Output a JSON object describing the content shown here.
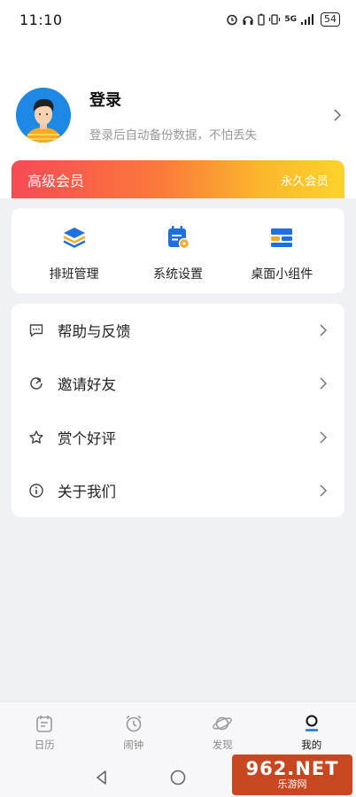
{
  "status_bar": {
    "time": "11:10",
    "network": "5G",
    "battery": "54"
  },
  "profile": {
    "title": "登录",
    "subtitle": "登录后自动备份数据，不怕丢失"
  },
  "member": {
    "left_label": "高级会员",
    "right_label": "永久会员"
  },
  "quick_actions": [
    {
      "label": "排班管理",
      "icon": "layers-icon"
    },
    {
      "label": "系统设置",
      "icon": "calendar-settings-icon"
    },
    {
      "label": "桌面小组件",
      "icon": "widget-icon"
    }
  ],
  "menu": [
    {
      "label": "帮助与反馈",
      "icon": "message-icon"
    },
    {
      "label": "邀请好友",
      "icon": "share-icon"
    },
    {
      "label": "赏个好评",
      "icon": "star-icon"
    },
    {
      "label": "关于我们",
      "icon": "info-icon"
    }
  ],
  "tabs": [
    {
      "label": "日历",
      "icon": "calendar-icon",
      "active": false
    },
    {
      "label": "闹钟",
      "icon": "alarm-icon",
      "active": false
    },
    {
      "label": "发现",
      "icon": "planet-icon",
      "active": false
    },
    {
      "label": "我的",
      "icon": "user-icon",
      "active": true
    }
  ],
  "watermark": {
    "top": "962.NET",
    "bottom": "乐游网"
  },
  "colors": {
    "accent_blue": "#1e6fe0",
    "banner_start": "#f84a55",
    "banner_end": "#fcd32a",
    "page_bg": "#f0f1f5"
  }
}
